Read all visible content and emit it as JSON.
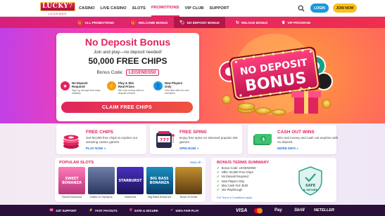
{
  "brand": {
    "logo_text": "LUCKY",
    "logo_suffix": "7",
    "logo_sub": "LEGENDS",
    "accent": "#e0245e",
    "secondary": "#1b9ad8",
    "gold": "#f7c21e"
  },
  "nav": {
    "links": [
      "CASINO",
      "LIVE CASINO",
      "SLOTS",
      "PROMOTIONS",
      "VIP CLUB",
      "SUPPORT"
    ],
    "active_index": 3,
    "login_label": "LOGIN",
    "join_label": "JOIN NOW",
    "search_icon": "search-icon"
  },
  "promo_tabs": [
    {
      "label": "ALL PROMOTIONS",
      "icon": "gift-icon"
    },
    {
      "label": "WELCOME BONUS",
      "icon": "gift-icon"
    },
    {
      "label": "NO DEPOSIT BONUS",
      "icon": "tag-icon"
    },
    {
      "label": "RELOAD BONUS",
      "icon": "reload-icon"
    },
    {
      "label": "VIP PROGRAM",
      "icon": "crown-icon"
    }
  ],
  "promo_active_index": 2,
  "hero": {
    "title": "No Deposit Bonus",
    "subtitle": "Join and play—no deposit needed!",
    "chips": "50,000 FREE CHIPS",
    "bonus_code_label": "Bonus Code:",
    "bonus_code": "LEGENDS50",
    "features": [
      {
        "title": "No Deposit",
        "title2": "Required",
        "desc": "Sign up and get free chips instantly",
        "icon": "pink-star-icon",
        "color": "#e0245e"
      },
      {
        "title": "Play & Win",
        "title2": "Real Prizes",
        "desc": "Win real money with no deposit needed",
        "icon": "lightning-icon",
        "color": "#f39c12"
      },
      {
        "title": "New Players",
        "title2": "Only",
        "desc": "One-time offer for new members",
        "icon": "person-icon",
        "color": "#1b9ad8"
      }
    ],
    "claim_label": "CLAIM FREE CHIPS",
    "how_label": "How It Works",
    "art_line1": "NO DEPOSIT",
    "art_line2": "BONUS"
  },
  "feature_cards": [
    {
      "title": "FREE CHIPS",
      "desc": "Get 50,000 free chips to explore our amazing casino games.",
      "link": "PLAY NOW »",
      "art": "chips-stack-icon"
    },
    {
      "title": "FREE SPINS",
      "desc": "Enjoy free spins on selected popular slot games.",
      "link": "SPIN NOW »",
      "art": "slot-machine-icon"
    },
    {
      "title": "CASH OUT WINS",
      "desc": "Win real money and cash out anytime with no deposit.",
      "link": "MORE INFO »",
      "art": "cash-icon"
    }
  ],
  "slots": {
    "title": "POPULAR SLOTS",
    "view_all": "View All ›",
    "games": [
      {
        "name": "Sweet Bonanza",
        "art_text": "SWEET\nBONANZA",
        "c1": "#ff7ab8",
        "c2": "#b8357a"
      },
      {
        "name": "Gates of Olympus",
        "art_text": "",
        "c1": "#6f7fa8",
        "c2": "#2b3660"
      },
      {
        "name": "Starburst",
        "art_text": "STARBURST",
        "c1": "#4b2fbf",
        "c2": "#1b1459"
      },
      {
        "name": "Big Bass Bonanza",
        "art_text": "BIG BASS\nBONANZA",
        "c1": "#1a8fbf",
        "c2": "#0a3f6a"
      },
      {
        "name": "Book of Dead",
        "art_text": "",
        "c1": "#c4902f",
        "c2": "#5a3a12"
      }
    ]
  },
  "terms": {
    "title": "BONUS TERMS SUMMARY",
    "items": [
      "Bonus Code: LEGENDS50",
      "Offer: 50,000 Free Chips",
      "No Deposit Required",
      "New Players Only",
      "Max Cash Out: $150",
      "40x Playthrough"
    ],
    "link": "Full Terms & Conditions apply",
    "badge_line1": "SAFE",
    "badge_line2": "& SECURE"
  },
  "footer": {
    "items": [
      {
        "label": "24/7 SUPPORT",
        "icon": "headset-icon"
      },
      {
        "label": "FAST PAYOUTS",
        "icon": "lightning-icon"
      },
      {
        "label": "SAFE & SECURE",
        "icon": "shield-icon"
      },
      {
        "label": "100% FAIR PLAY",
        "icon": "check-icon"
      }
    ],
    "payments": [
      "VISA",
      "mastercard",
      "Pay",
      "Skrill",
      "NETELLER"
    ]
  }
}
